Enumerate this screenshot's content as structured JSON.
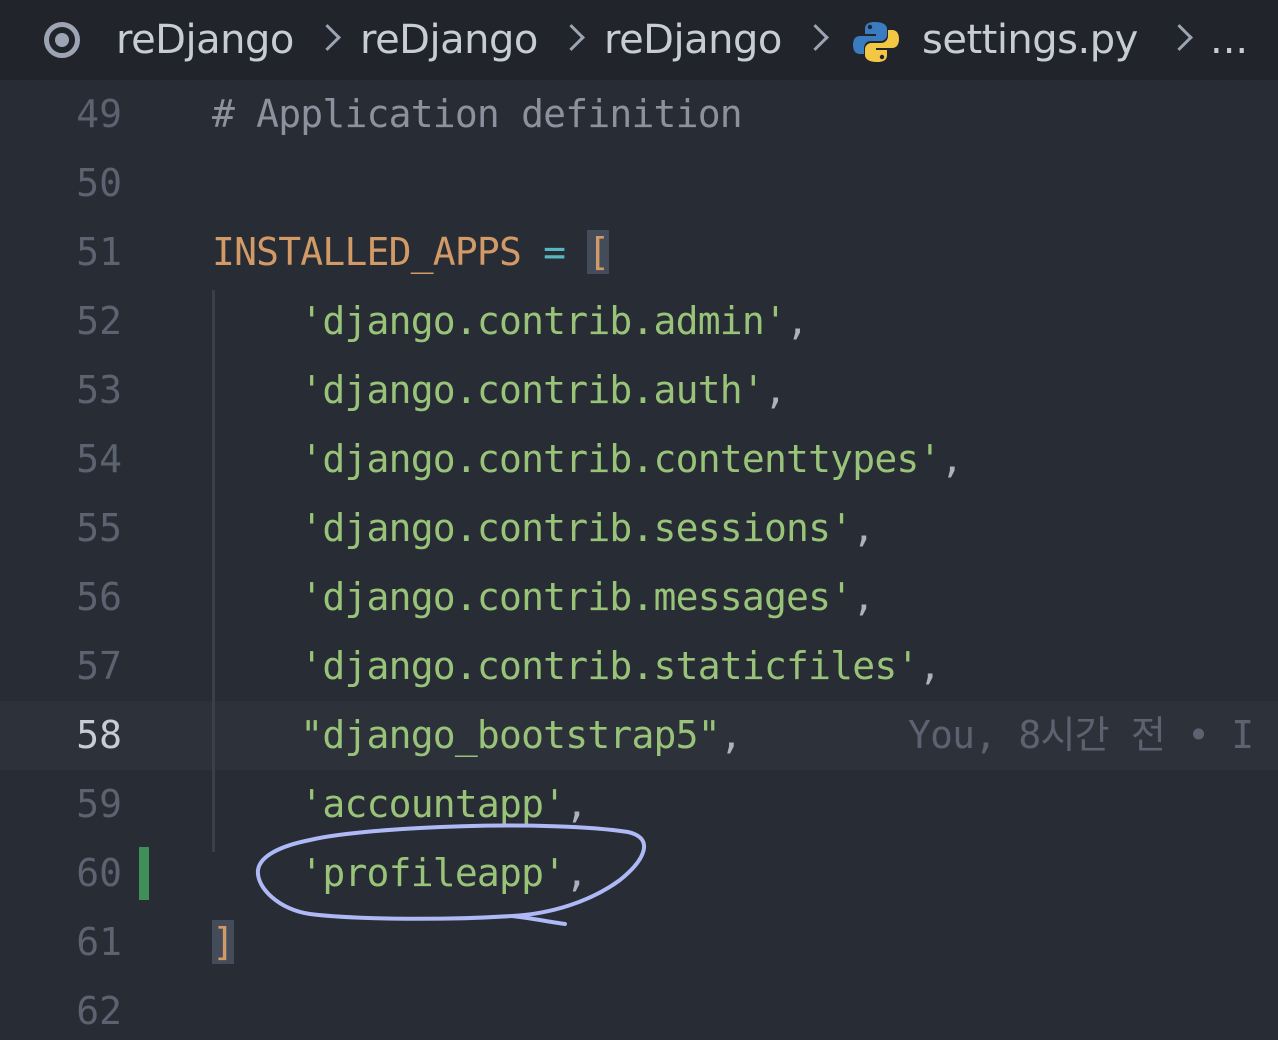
{
  "breadcrumb": {
    "items": [
      "reDjango",
      "reDjango",
      "reDjango",
      "settings.py"
    ],
    "ellipsis": "..."
  },
  "editor": {
    "current_line": 58,
    "lines": [
      {
        "num": "49",
        "tokens": [
          {
            "cls": "comment",
            "text": "# Application definition"
          }
        ]
      },
      {
        "num": "50",
        "tokens": []
      },
      {
        "num": "51",
        "tokens": [
          {
            "cls": "ident",
            "text": "INSTALLED_APPS"
          },
          {
            "cls": "op",
            "text": " = "
          },
          {
            "cls": "bracket-hl",
            "text": "["
          }
        ]
      },
      {
        "num": "52",
        "tokens": [
          {
            "cls": "str",
            "text": "    'django.contrib.admin'"
          },
          {
            "cls": "punc",
            "text": ","
          }
        ]
      },
      {
        "num": "53",
        "tokens": [
          {
            "cls": "str",
            "text": "    'django.contrib.auth'"
          },
          {
            "cls": "punc",
            "text": ","
          }
        ]
      },
      {
        "num": "54",
        "tokens": [
          {
            "cls": "str",
            "text": "    'django.contrib.contenttypes'"
          },
          {
            "cls": "punc",
            "text": ","
          }
        ]
      },
      {
        "num": "55",
        "tokens": [
          {
            "cls": "str",
            "text": "    'django.contrib.sessions'"
          },
          {
            "cls": "punc",
            "text": ","
          }
        ]
      },
      {
        "num": "56",
        "tokens": [
          {
            "cls": "str",
            "text": "    'django.contrib.messages'"
          },
          {
            "cls": "punc",
            "text": ","
          }
        ]
      },
      {
        "num": "57",
        "tokens": [
          {
            "cls": "str",
            "text": "    'django.contrib.staticfiles'"
          },
          {
            "cls": "punc",
            "text": ","
          }
        ]
      },
      {
        "num": "58",
        "tokens": [
          {
            "cls": "str",
            "text": "    \"django_bootstrap5\""
          },
          {
            "cls": "punc",
            "text": ","
          }
        ]
      },
      {
        "num": "59",
        "tokens": [
          {
            "cls": "str",
            "text": "    'accountapp'"
          },
          {
            "cls": "punc",
            "text": ","
          }
        ]
      },
      {
        "num": "60",
        "tokens": [
          {
            "cls": "str",
            "text": "    'profileapp'"
          },
          {
            "cls": "punc",
            "text": ","
          }
        ]
      },
      {
        "num": "61",
        "tokens": [
          {
            "cls": "bracket-hl",
            "text": "]"
          }
        ]
      },
      {
        "num": "62",
        "tokens": []
      }
    ],
    "blame_text": "You, 8시간 전 • I"
  },
  "colors": {
    "background": "#282c34",
    "string": "#98c379",
    "identifier": "#d19a66",
    "operator": "#56b6c2",
    "comment": "#8b919d",
    "git_added": "#3f8f5b",
    "annotation": "#aeb9f5"
  }
}
